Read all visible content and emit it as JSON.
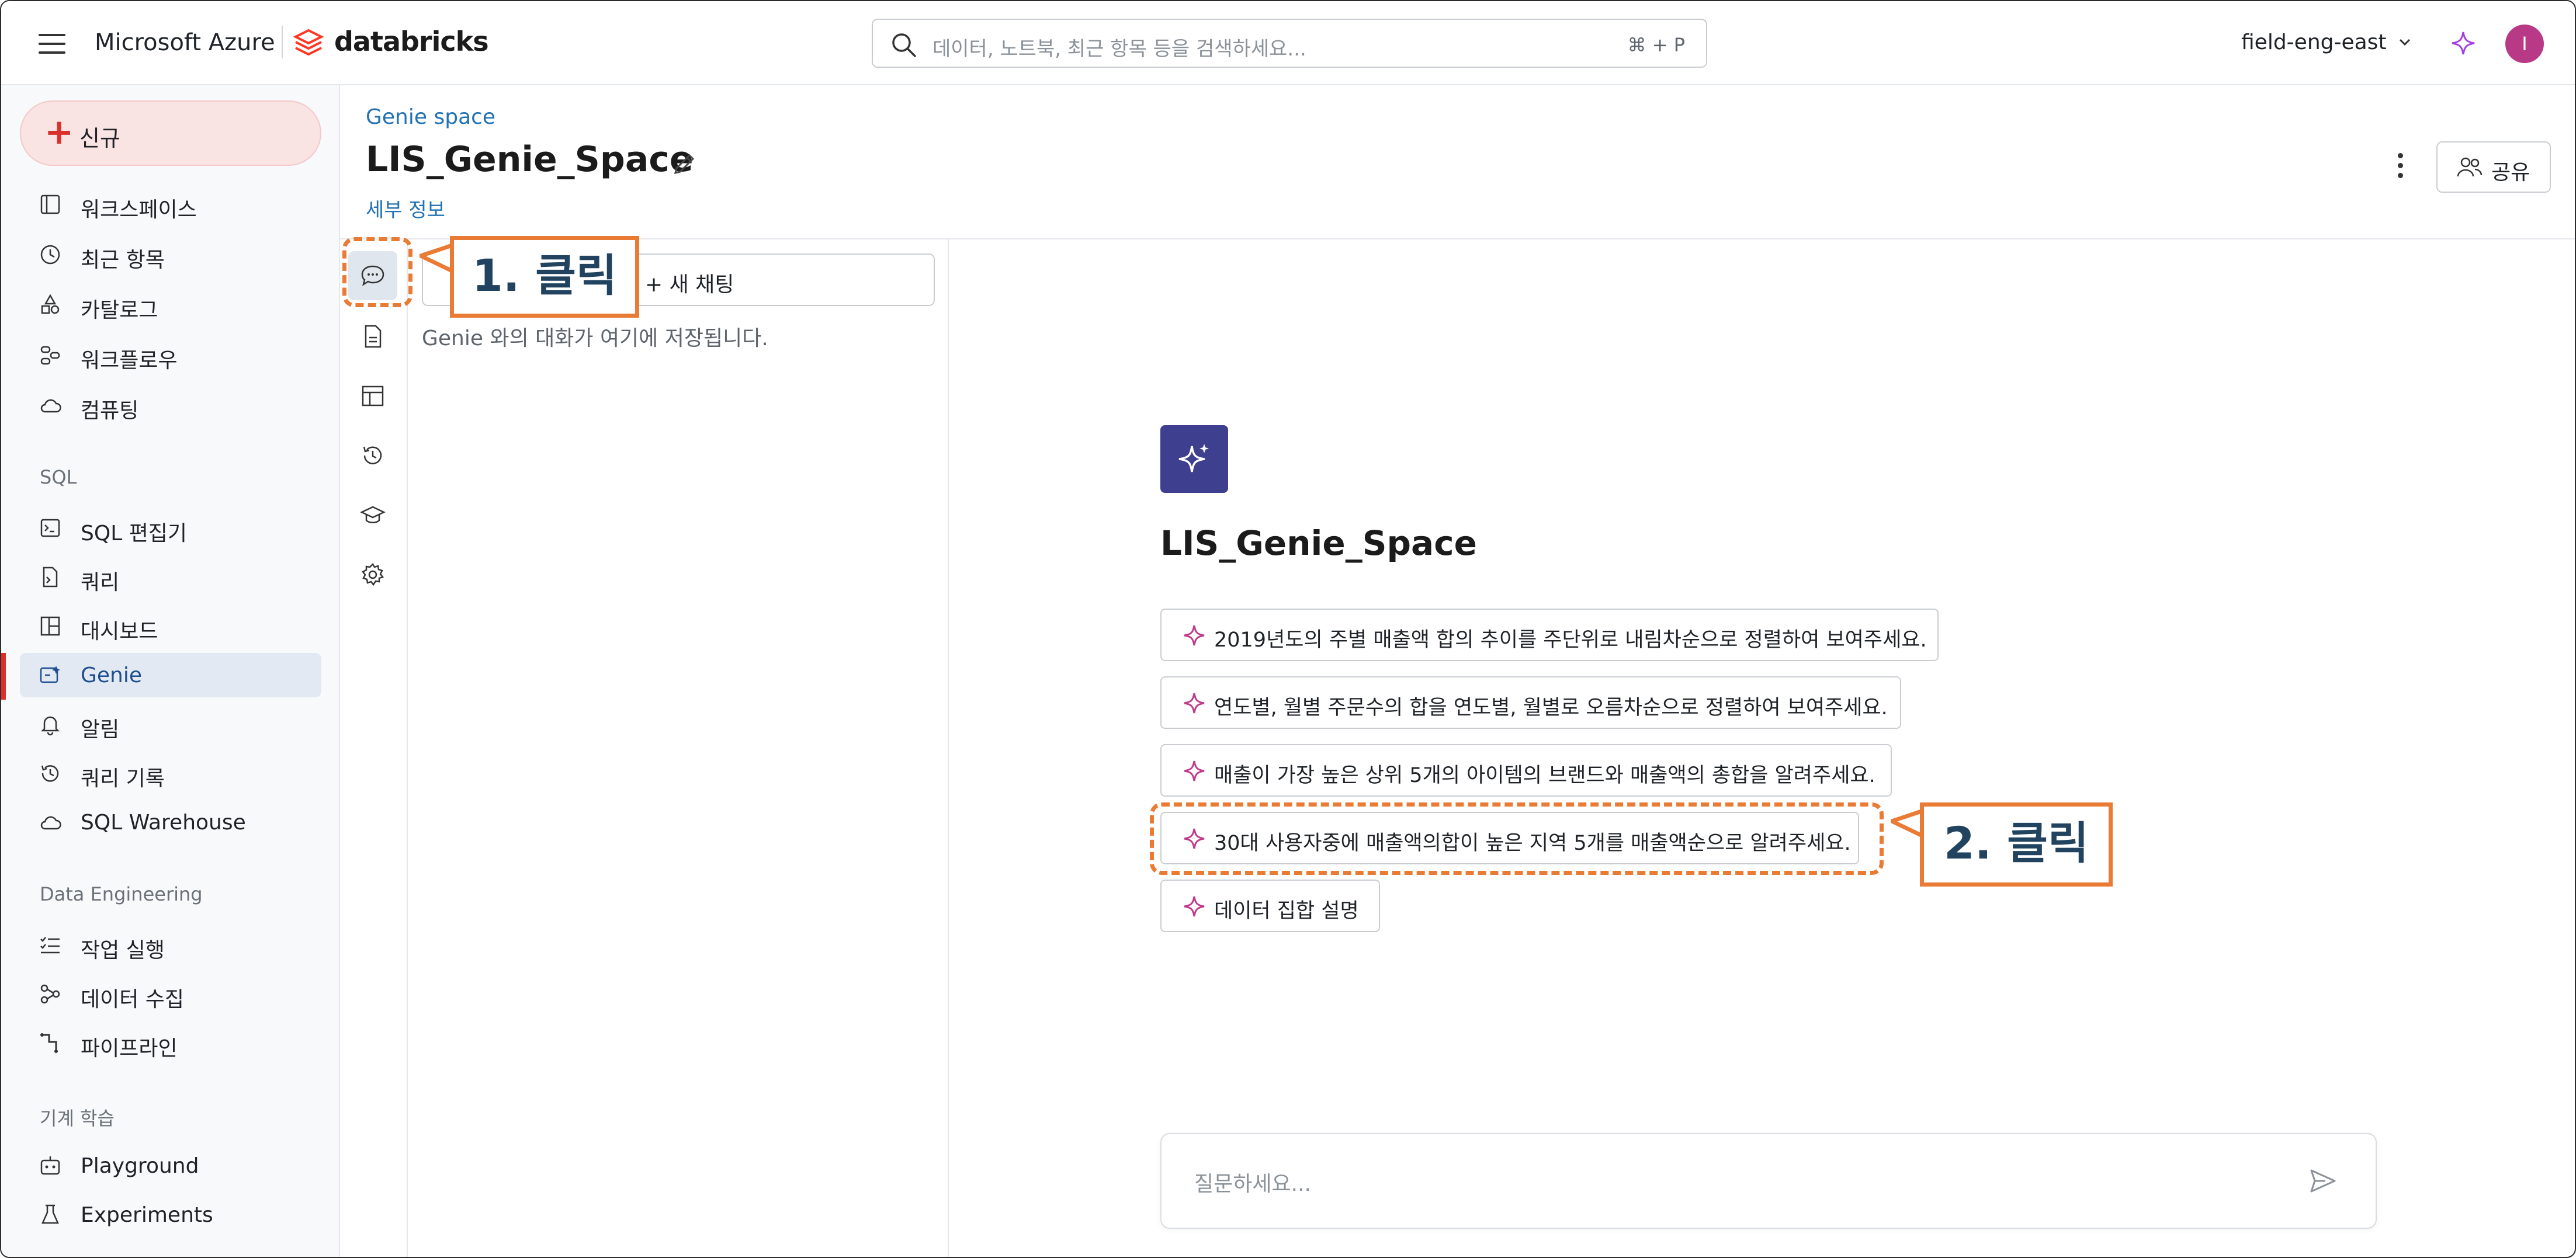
{
  "topbar": {
    "brand_ms": "Microsoft Azure",
    "brand_db": "databricks",
    "search_placeholder": "데이터, 노트북, 최근 항목 등을 검색하세요...",
    "search_shortcut": "⌘ + P",
    "workspace": "field-eng-east",
    "avatar_initial": "I"
  },
  "sidebar": {
    "new_label": "신규",
    "items_top": [
      {
        "label": "워크스페이스",
        "icon": "workspace-icon"
      },
      {
        "label": "최근 항목",
        "icon": "clock-icon"
      },
      {
        "label": "카탈로그",
        "icon": "catalog-icon"
      },
      {
        "label": "워크플로우",
        "icon": "workflow-icon"
      },
      {
        "label": "컴퓨팅",
        "icon": "cloud-icon"
      }
    ],
    "sql_header": "SQL",
    "items_sql": [
      {
        "label": "SQL 편집기",
        "icon": "sql-editor-icon"
      },
      {
        "label": "쿼리",
        "icon": "query-icon"
      },
      {
        "label": "대시보드",
        "icon": "dashboard-icon"
      },
      {
        "label": "Genie",
        "icon": "genie-icon",
        "active": true
      },
      {
        "label": "알림",
        "icon": "bell-icon"
      },
      {
        "label": "쿼리 기록",
        "icon": "history-icon"
      },
      {
        "label": "SQL Warehouse",
        "icon": "warehouse-icon"
      }
    ],
    "de_header": "Data Engineering",
    "items_de": [
      {
        "label": "작업 실행",
        "icon": "job-runs-icon"
      },
      {
        "label": "데이터 수집",
        "icon": "ingest-icon"
      },
      {
        "label": "파이프라인",
        "icon": "pipeline-icon"
      }
    ],
    "ml_header": "기계 학습",
    "items_ml": [
      {
        "label": "Playground",
        "icon": "robot-icon"
      },
      {
        "label": "Experiments",
        "icon": "flask-icon"
      }
    ]
  },
  "header": {
    "breadcrumb": "Genie space",
    "title": "LIS_Genie_Space",
    "details_link": "세부 정보",
    "share_label": "공유"
  },
  "history": {
    "new_chat_label": "+ 새 채팅",
    "empty_text": "Genie 와의 대화가 여기에 저장됩니다."
  },
  "genie": {
    "space_name": "LIS_Genie_Space",
    "suggestions": [
      "2019년도의 주별 매출액 합의 추이를 주단위로 내림차순으로 정렬하여 보여주세요.",
      "연도별, 월별 주문수의 합을 연도별, 월별로 오름차순으로 정렬하여 보여주세요.",
      "매출이 가장 높은 상위 5개의 아이템의 브랜드와 매출액의 총합을 알려주세요.",
      "30대 사용자중에 매출액의합이 높은 지역 5개를 매출액순으로 알려주세요.",
      "데이터 집합 설명"
    ],
    "input_placeholder": "질문하세요..."
  },
  "annotations": {
    "step1": "1. 클릭",
    "step2": "2. 클릭",
    "color": "#e97b35"
  },
  "colors": {
    "accent_red": "#d9302c",
    "link_blue": "#2272b4",
    "genie_purple": "#3f3f8f",
    "active_bg": "#e3e9f2"
  }
}
